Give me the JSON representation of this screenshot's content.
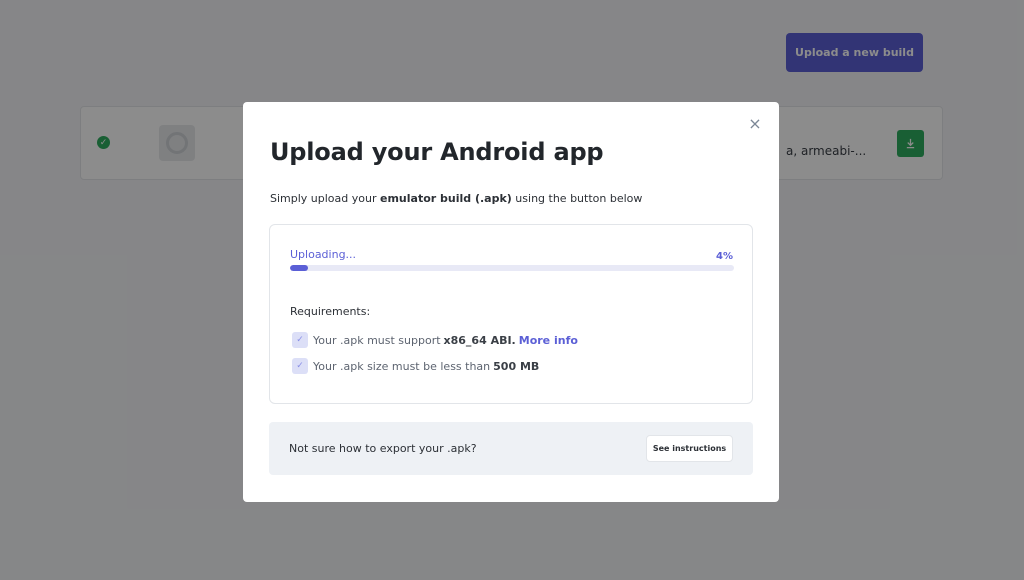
{
  "background": {
    "upload_new_build_label": "Upload a new build",
    "build_card": {
      "status_icon": "check-circle-icon",
      "abi_text": "a, armeabi-...",
      "download_icon": "download-icon"
    }
  },
  "modal": {
    "close_icon": "close-icon",
    "close_glyph": "×",
    "title": "Upload your Android app",
    "subtitle": {
      "prefix": "Simply upload your ",
      "emphasis": "emulator build (.apk)",
      "suffix": " using the button below"
    },
    "upload": {
      "status": "Uploading...",
      "percent_label": "4%",
      "progress_fraction": 0.04
    },
    "requirements": {
      "heading": "Requirements:",
      "items": [
        {
          "text_prefix": "Your .apk must support",
          "emphasis": "x86_64 ABI.",
          "link": "More info"
        },
        {
          "text_prefix": "Your .apk size must be less than",
          "emphasis": "500 MB",
          "link": ""
        }
      ]
    },
    "help": {
      "text": "Not sure how to export your .apk?",
      "button_label": "See instructions"
    }
  },
  "colors": {
    "accent": "#5b5fd6",
    "success": "#2fae5f",
    "overlay": "rgba(0,0,0,0.45)"
  }
}
